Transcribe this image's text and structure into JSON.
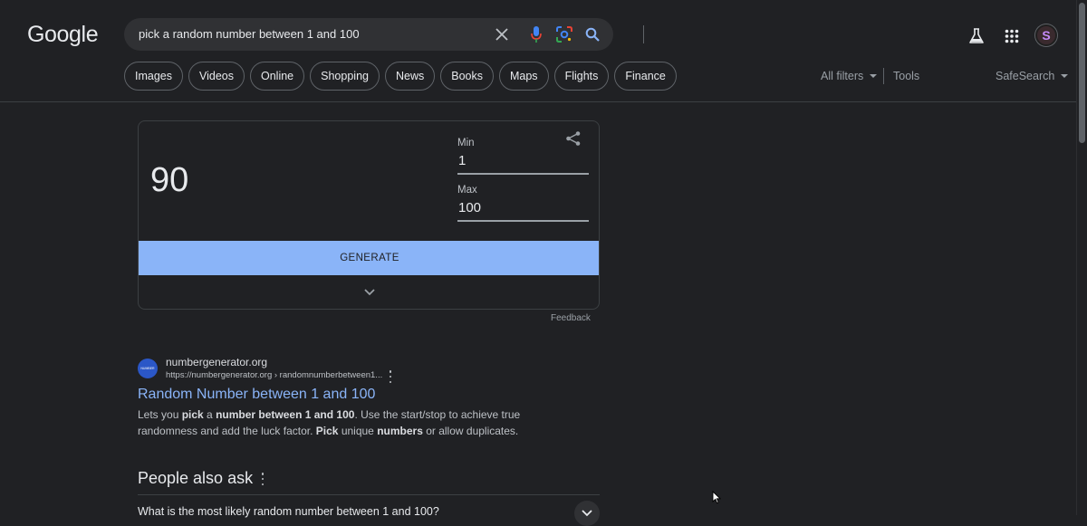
{
  "header": {
    "logo": "Google",
    "search_query": "pick a random number between 1 and 100",
    "icons": [
      "close-icon",
      "microphone-icon",
      "lens-icon",
      "search-icon",
      "labs-flask-icon",
      "apps-grid-icon"
    ],
    "avatar_letter": "S"
  },
  "chips": [
    "Images",
    "Videos",
    "Online",
    "Shopping",
    "News",
    "Books",
    "Maps",
    "Flights",
    "Finance"
  ],
  "filters": {
    "all_filters": "All filters",
    "tools": "Tools",
    "safesearch": "SafeSearch"
  },
  "rng_card": {
    "result": "90",
    "min_label": "Min",
    "min_value": "1",
    "max_label": "Max",
    "max_value": "100",
    "generate_label": "GENERATE",
    "feedback": "Feedback",
    "accent_color": "#8ab4f8"
  },
  "search_result": {
    "favicon_text": "NUMBER GENERATOR",
    "site_name": "numbergenerator.org",
    "url": "https://numbergenerator.org › randomnumberbetween1...",
    "title": "Random Number between 1 and 100",
    "snippet_parts": [
      {
        "text": "Lets you ",
        "bold": false
      },
      {
        "text": "pick",
        "bold": true
      },
      {
        "text": " a ",
        "bold": false
      },
      {
        "text": "number between 1 and 100",
        "bold": true
      },
      {
        "text": ". Use the start/stop to achieve true randomness and add the luck factor. ",
        "bold": false
      },
      {
        "text": "Pick",
        "bold": true
      },
      {
        "text": " unique ",
        "bold": false
      },
      {
        "text": "numbers",
        "bold": true
      },
      {
        "text": " or allow duplicates.",
        "bold": false
      }
    ]
  },
  "people_also_ask": {
    "title": "People also ask",
    "questions": [
      "What is the most likely random number between 1 and 100?"
    ]
  }
}
